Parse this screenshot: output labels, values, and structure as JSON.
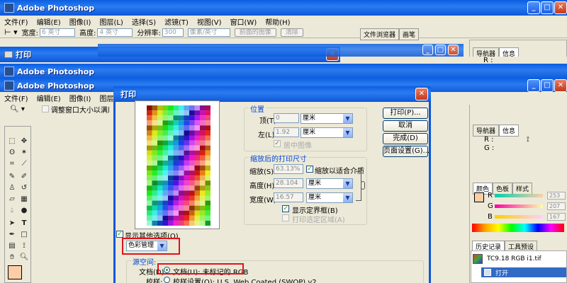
{
  "app": {
    "title": "Adobe Photoshop",
    "menu": [
      "文件(F)",
      "编辑(E)",
      "图像(I)",
      "图层(L)",
      "选择(S)",
      "滤镜(T)",
      "视图(V)",
      "窗口(W)",
      "帮助(H)"
    ]
  },
  "options_bar": {
    "width_label": "宽度:",
    "width_value": "6 英寸",
    "height_label": "高度:",
    "height_value": "4 英寸",
    "resolution_label": "分辨率:",
    "resolution_value": "300",
    "resolution_unit": "像素/英寸",
    "front_image_button": "前面的图像",
    "clear_button": "清除",
    "fit_window_label": "调整窗口大小以满屏"
  },
  "top_panel_tabs": [
    "文件浏览器",
    "画笔"
  ],
  "print_window_back": {
    "title": "打印"
  },
  "second_app": {
    "title": "Adobe Photoshop"
  },
  "navigator_tabs": [
    "导航器",
    "信息"
  ],
  "info_labels": {
    "r": "R :",
    "g": "G :"
  },
  "info_tabs_2": [
    "导航器",
    "信息"
  ],
  "color_tabs": [
    "颜色",
    "色板",
    "样式"
  ],
  "color_values": {
    "r_label": "R",
    "g_label": "G",
    "b_label": "B",
    "r": "253",
    "g": "207",
    "b": "167"
  },
  "history_tabs": [
    "历史记录",
    "工具预设"
  ],
  "history_items": {
    "file": "TC9.18 RGB i1.tif",
    "step": "打开"
  },
  "fg_color": "#fccda7",
  "print_dialog": {
    "title": "打印",
    "position_group": "位置",
    "top_label": "顶(T):",
    "top_value": "0",
    "top_unit": "厘米",
    "left_label": "左(L):",
    "left_value": "1.92",
    "left_unit": "厘米",
    "center_image": "居中图像",
    "scaled_group": "缩放后的打印尺寸",
    "scale_label": "缩放(S):",
    "scale_value": "63.13%",
    "scale_to_fit": "缩放以适合介质",
    "height_label": "高度(H):",
    "height_value": "28.104",
    "height_unit": "厘米",
    "width_label": "宽度(W):",
    "width_value": "16.57",
    "width_unit": "厘米",
    "show_bounding_box": "显示定界框(B)",
    "print_selected_area": "打印选定区域(A)",
    "buttons": [
      "打印(P)...",
      "取消",
      "完成(D)",
      "页面设置(G)..."
    ],
    "show_more_options": "显示其他选项(O)",
    "color_management": "色彩管理",
    "source_space": "源空间:",
    "document_label": "文档(D):",
    "document_value": "文档(U): 未标记的 RGB",
    "proof_label": "校样:",
    "proof_value": "校样设置(O): U.S. Web Coated (SWOP) v2"
  }
}
